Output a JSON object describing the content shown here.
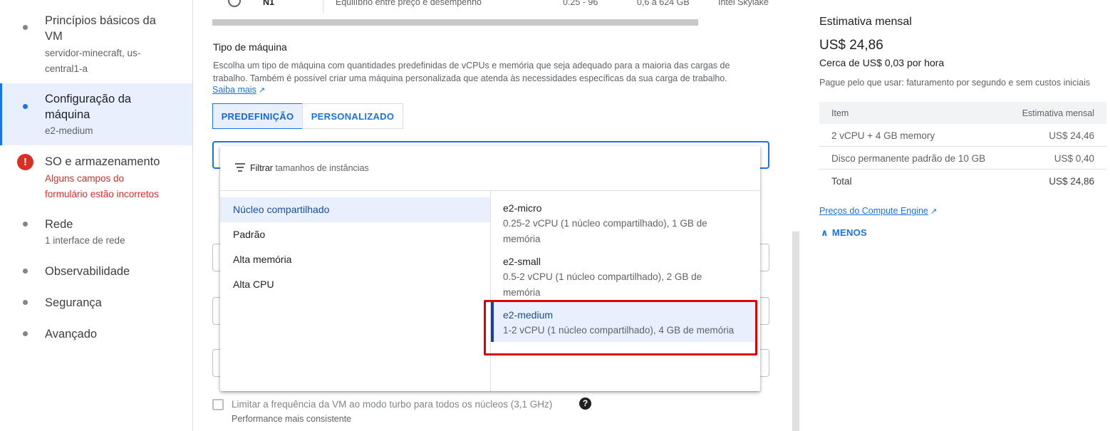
{
  "sidebar": {
    "steps": [
      {
        "title_line1": "Princípios básicos da",
        "title_line2": "VM",
        "sub_line1": "servidor-minecraft, us-",
        "sub_line2": "central1-a"
      },
      {
        "title_line1": "Configuração da",
        "title_line2": "máquina",
        "sub_line1": "e2-medium"
      },
      {
        "title_line1": "SO e armazenamento",
        "error_line1": "Alguns campos do",
        "error_line2": "formulário estão incorretos",
        "error_icon": "!"
      },
      {
        "title_line1": "Rede",
        "sub_line1": "1 interface de rede"
      },
      {
        "title_line1": "Observabilidade"
      },
      {
        "title_line1": "Segurança"
      },
      {
        "title_line1": "Avançado"
      }
    ]
  },
  "series_row": {
    "name": "N1",
    "description": "Equilíbrio entre preço e desempenho",
    "vcpus": "0.25 - 96",
    "memory": "0,6 a 624 GB",
    "platform": "Intel Skylake"
  },
  "machine_type": {
    "title": "Tipo de máquina",
    "description": "Escolha um tipo de máquina com quantidades predefinidas de vCPUs e memória que seja adequado para a maioria das cargas de trabalho. Também é possível criar uma máquina personalizada que atenda às necessidades específicas da sua carga de trabalho.",
    "learn_more": "Saiba mais",
    "tabs": [
      "PREDEFINIÇÃO",
      "PERSONALIZADO"
    ],
    "selected_tab": 0
  },
  "dropdown": {
    "filter_label": "Filtrar",
    "filter_placeholder": "tamanhos de instâncias",
    "families": [
      "Núcleo compartilhado",
      "Padrão",
      "Alta memória",
      "Alta CPU"
    ],
    "selected_family": 0,
    "options": [
      {
        "name": "e2-micro",
        "desc": "0.25-2 vCPU (1 núcleo compartilhado), 1 GB de memória"
      },
      {
        "name": "e2-small",
        "desc": "0.5-2 vCPU (1 núcleo compartilhado), 2 GB de memória"
      },
      {
        "name": "e2-medium",
        "desc": "1-2 vCPU (1 núcleo compartilhado), 4 GB de memória"
      }
    ],
    "selected_option": 2
  },
  "turbo_limit": {
    "label": "Limitar a frequência da VM ao modo turbo para todos os núcleos (3,1 GHz)",
    "sub": "Performance mais consistente",
    "help": "?"
  },
  "estimate": {
    "title": "Estimativa mensal",
    "price": "US$ 24,86",
    "hourly": "Cerca de US$ 0,03 por hora",
    "note": "Pague pelo que usar: faturamento por segundo e sem custos iniciais",
    "table_headers": [
      "Item",
      "Estimativa mensal"
    ],
    "rows": [
      {
        "item": "2 vCPU + 4 GB memory",
        "cost": "US$ 24,46"
      },
      {
        "item": "Disco permanente padrão de 10 GB",
        "cost": "US$ 0,40"
      },
      {
        "item": "Total",
        "cost": "US$ 24,86"
      }
    ],
    "pricing_link": "Preços do Compute Engine",
    "less_button": "MENOS"
  },
  "colors": {
    "accent": "#1a73e8",
    "error": "#d93025",
    "highlight": "#e00000"
  }
}
